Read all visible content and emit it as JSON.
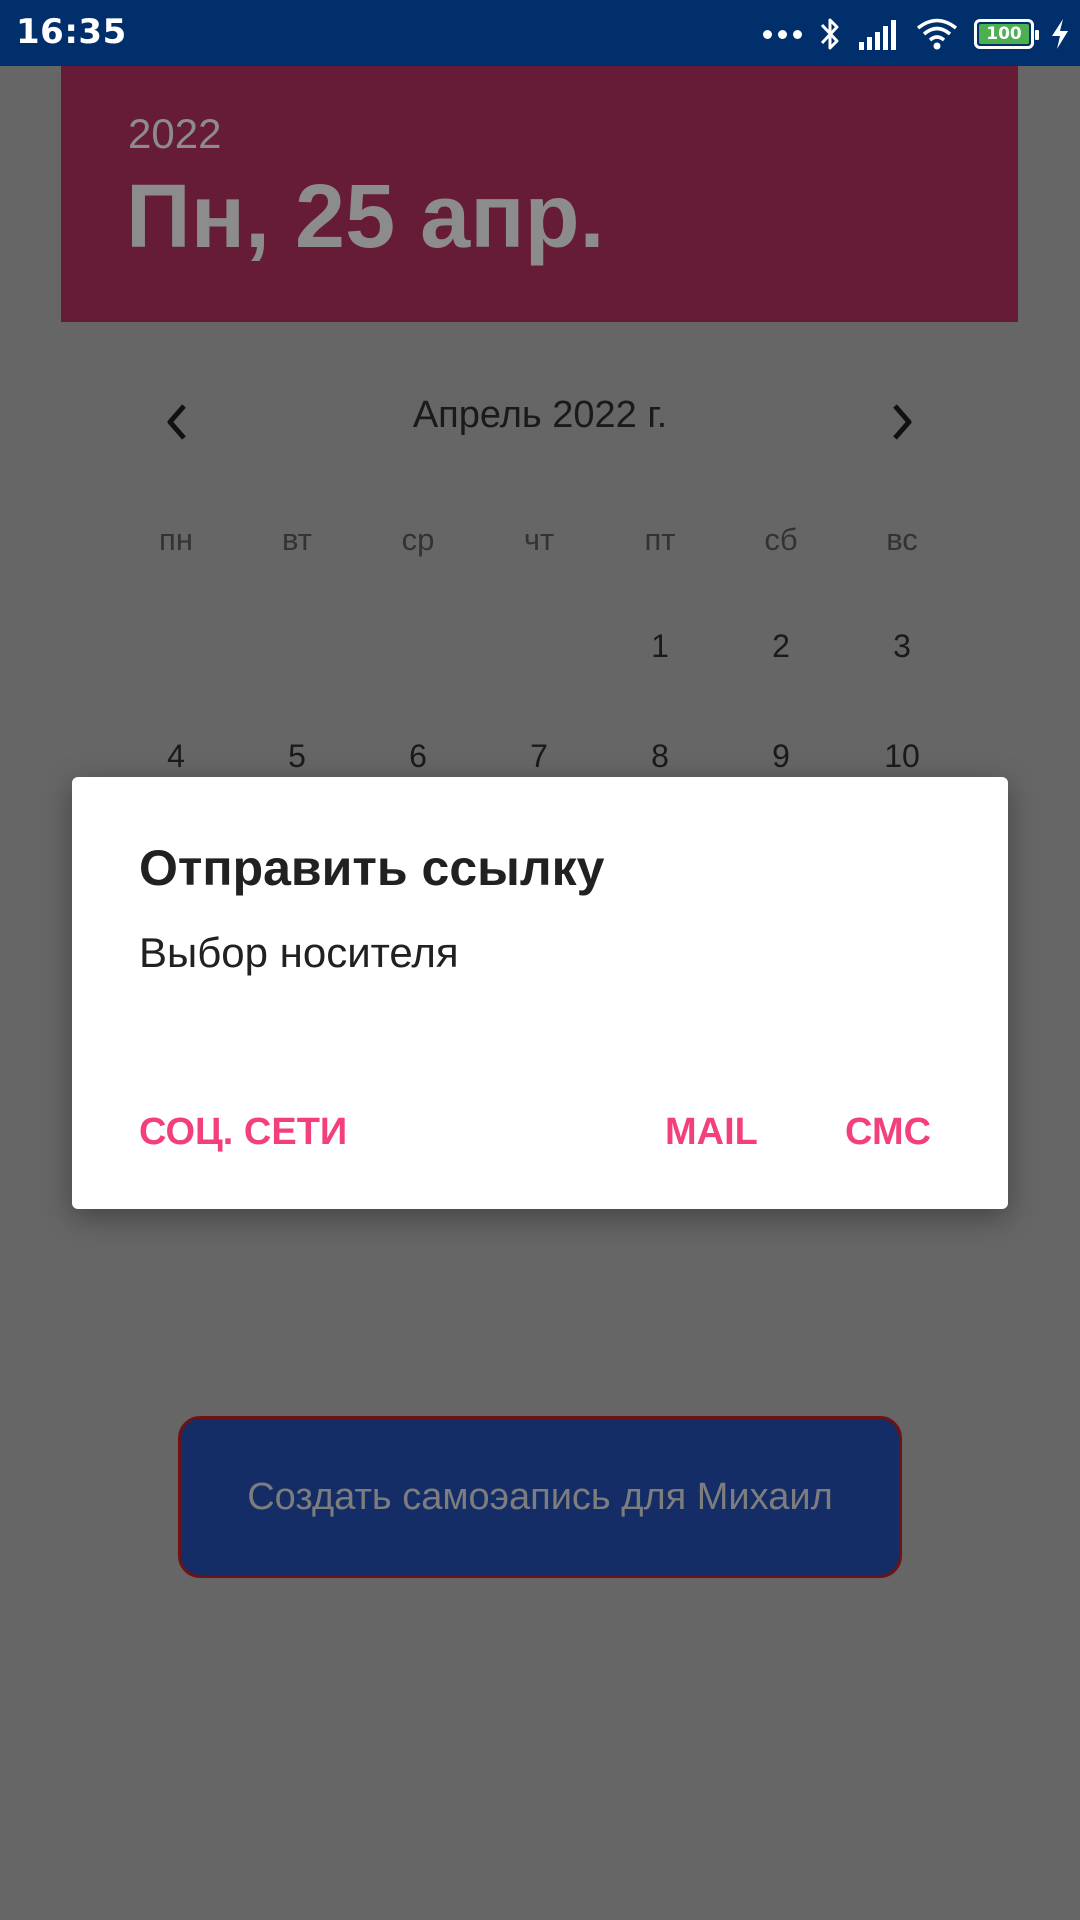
{
  "status_bar": {
    "time": "16:35",
    "battery": "100",
    "icons": [
      "more-dots-icon",
      "bluetooth-icon",
      "signal-icon",
      "wifi-icon",
      "battery-icon",
      "charging-bolt-icon"
    ]
  },
  "date_header": {
    "year": "2022",
    "date": "Пн, 25 апр."
  },
  "calendar": {
    "month": "Апрель 2022 г.",
    "weekdays": [
      "пн",
      "вт",
      "ср",
      "чт",
      "пт",
      "сб",
      "вс"
    ],
    "row1": [
      "1",
      "2",
      "3"
    ],
    "row2": [
      "4",
      "5",
      "6",
      "7",
      "8",
      "9",
      "10"
    ]
  },
  "create_button": {
    "label": "Создать самоэапись для Михаил"
  },
  "dialog": {
    "title": "Отправить ссылку",
    "message": "Выбор носителя",
    "buttons": {
      "social": "СОЦ. СЕТИ",
      "mail": "MAIL",
      "sms": "СМС"
    }
  },
  "colors": {
    "status_bar": "#002f6c",
    "header": "#661b37",
    "accent": "#f43f7d",
    "button": "#142d66"
  }
}
